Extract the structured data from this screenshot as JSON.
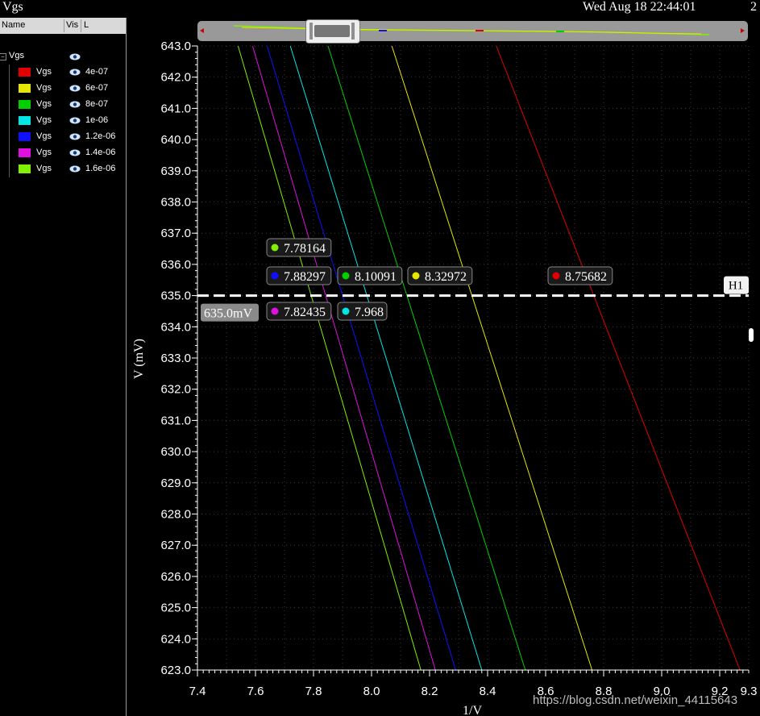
{
  "window": {
    "title": "Vgs",
    "datetime": "Wed Aug 18 22:44:01",
    "date_suffix": "2"
  },
  "panel": {
    "columns": {
      "name": "Name",
      "vis": "Vis",
      "l": "L"
    },
    "root_label": "Vgs",
    "rows": [
      {
        "name": "Vgs",
        "value": "4e-07",
        "color": "#e00000"
      },
      {
        "name": "Vgs",
        "value": "6e-07",
        "color": "#e6e600"
      },
      {
        "name": "Vgs",
        "value": "8e-07",
        "color": "#00d000"
      },
      {
        "name": "Vgs",
        "value": "1e-06",
        "color": "#00e6e6"
      },
      {
        "name": "Vgs",
        "value": "1.2e-06",
        "color": "#1010ff"
      },
      {
        "name": "Vgs",
        "value": "1.4e-06",
        "color": "#e010e0"
      },
      {
        "name": "Vgs",
        "value": "1.6e-06",
        "color": "#80f000"
      }
    ]
  },
  "watermark": "https://blog.csdn.net/weixin_44115643",
  "chart_data": {
    "type": "line",
    "xlabel": "1/V",
    "ylabel": "V (mV)",
    "xlim": [
      7.4,
      9.3
    ],
    "ylim": [
      623.0,
      643.0
    ],
    "x_ticks": [
      "7.4",
      "7.6",
      "7.8",
      "8.0",
      "8.2",
      "8.4",
      "8.6",
      "8.8",
      "9.0",
      "9.2",
      "9.3"
    ],
    "y_ticks": [
      "643.0",
      "642.0",
      "641.0",
      "640.0",
      "639.0",
      "638.0",
      "637.0",
      "636.0",
      "635.0",
      "634.0",
      "633.0",
      "632.0",
      "631.0",
      "630.0",
      "629.0",
      "628.0",
      "627.0",
      "626.0",
      "625.0",
      "624.0",
      "623.0"
    ],
    "grid": true,
    "series": [
      {
        "name": "4e-07",
        "color": "#e00000",
        "x": [
          8.43,
          9.27
        ],
        "y": [
          643.0,
          623.0
        ]
      },
      {
        "name": "6e-07",
        "color": "#e6e600",
        "x": [
          8.07,
          8.76
        ],
        "y": [
          643.0,
          623.0
        ]
      },
      {
        "name": "8e-07",
        "color": "#00d000",
        "x": [
          7.85,
          8.53
        ],
        "y": [
          643.0,
          623.0
        ]
      },
      {
        "name": "1e-06",
        "color": "#00e6e6",
        "x": [
          7.72,
          8.38
        ],
        "y": [
          643.0,
          623.0
        ]
      },
      {
        "name": "1.2e-06",
        "color": "#1010ff",
        "x": [
          7.64,
          8.29
        ],
        "y": [
          643.0,
          623.0
        ]
      },
      {
        "name": "1.4e-06",
        "color": "#e010e0",
        "x": [
          7.59,
          8.22
        ],
        "y": [
          643.0,
          623.0
        ]
      },
      {
        "name": "1.6e-06",
        "color": "#80f000",
        "x": [
          7.54,
          8.17
        ],
        "y": [
          643.0,
          623.0
        ]
      }
    ],
    "hline": {
      "label": "H1",
      "value": 635.0,
      "value_label": "635.0mV"
    },
    "markers": [
      {
        "label": "7.78164",
        "color": "#80f000",
        "row": 0
      },
      {
        "label": "7.88297",
        "color": "#1010ff",
        "row": 1
      },
      {
        "label": "8.10091",
        "color": "#00d000",
        "row": 1
      },
      {
        "label": "8.32972",
        "color": "#e6e600",
        "row": 1
      },
      {
        "label": "8.75682",
        "color": "#e00000",
        "row": 1
      },
      {
        "label": "7.82435",
        "color": "#e010e0",
        "row": 2
      },
      {
        "label": "7.968",
        "color": "#00e6e6",
        "row": 2
      }
    ]
  }
}
